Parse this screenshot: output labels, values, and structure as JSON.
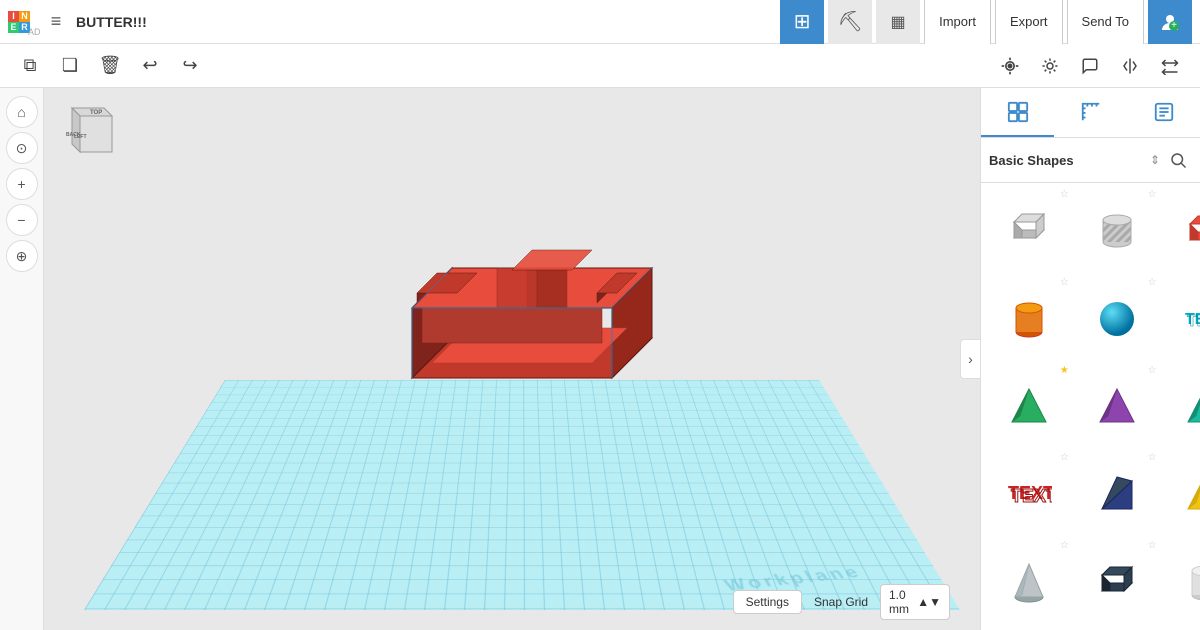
{
  "app": {
    "logo_letters": [
      "I",
      "N",
      "E",
      "R",
      "A",
      "D"
    ],
    "project_title": "BUTTER!!!",
    "nav_tabs": [
      {
        "id": "grid",
        "icon": "⊞",
        "active": true
      },
      {
        "id": "tools",
        "icon": "⛏",
        "active": false
      },
      {
        "id": "layers",
        "icon": "▦",
        "active": false
      }
    ],
    "nav_actions": [
      "Import",
      "Export",
      "Send To"
    ],
    "user_icon": "👤"
  },
  "toolbar": {
    "tools": [
      {
        "id": "copy",
        "icon": "⧉"
      },
      {
        "id": "duplicate",
        "icon": "❏"
      },
      {
        "id": "delete",
        "icon": "🗑"
      },
      {
        "id": "undo",
        "icon": "↩"
      },
      {
        "id": "redo",
        "icon": "↪"
      }
    ],
    "right_tools": [
      {
        "id": "camera",
        "icon": "📷"
      },
      {
        "id": "light",
        "icon": "💡"
      },
      {
        "id": "comment",
        "icon": "💬"
      },
      {
        "id": "mirror",
        "icon": "⟺"
      },
      {
        "id": "flip",
        "icon": "⟳"
      }
    ]
  },
  "left_sidebar": {
    "buttons": [
      {
        "id": "home",
        "icon": "⌂"
      },
      {
        "id": "fit",
        "icon": "⊙"
      },
      {
        "id": "zoom-in",
        "icon": "+"
      },
      {
        "id": "zoom-out",
        "icon": "−"
      },
      {
        "id": "orbit",
        "icon": "⊕"
      }
    ]
  },
  "viewport": {
    "workplane_label": "Workplane",
    "settings_label": "Settings",
    "snap_grid_label": "Snap Grid",
    "snap_grid_value": "1.0 mm"
  },
  "right_panel": {
    "tabs": [
      {
        "id": "shapes",
        "icon": "⊞",
        "active": true
      },
      {
        "id": "rulers",
        "icon": "📐",
        "active": false
      },
      {
        "id": "notes",
        "icon": "📝",
        "active": false
      }
    ],
    "shapes_category": "Basic Shapes",
    "shapes": [
      {
        "id": "box",
        "label": "Box",
        "color": "#aaa",
        "starred": false
      },
      {
        "id": "cylinder-striped",
        "label": "Cylinder Striped",
        "color": "#bbb",
        "starred": false
      },
      {
        "id": "box-red",
        "label": "Box Red",
        "color": "#e74c3c",
        "starred": false
      },
      {
        "id": "cylinder",
        "label": "Cylinder",
        "color": "#e67e22",
        "starred": false
      },
      {
        "id": "sphere",
        "label": "Sphere",
        "color": "#00aacc",
        "starred": false
      },
      {
        "id": "text3d",
        "label": "3D Text",
        "color": "#cc3333",
        "starred": false
      },
      {
        "id": "pyramid-green",
        "label": "Pyramid Green",
        "color": "#27ae60",
        "starred": true
      },
      {
        "id": "pyramid-purple",
        "label": "Pyramid Purple",
        "color": "#8e44ad",
        "starred": false
      },
      {
        "id": "pyramid-teal",
        "label": "Pyramid Teal",
        "color": "#1abc9c",
        "starred": false
      },
      {
        "id": "text-red",
        "label": "Text Red",
        "color": "#cc2222",
        "starred": false
      },
      {
        "id": "prism-blue",
        "label": "Prism Blue",
        "color": "#2c3e80",
        "starred": false
      },
      {
        "id": "pyramid-yellow",
        "label": "Pyramid Yellow",
        "color": "#f1c40f",
        "starred": false
      },
      {
        "id": "cone-gray",
        "label": "Cone Gray",
        "color": "#95a5a6",
        "starred": false
      },
      {
        "id": "box-blue",
        "label": "Box Blue",
        "color": "#34495e",
        "starred": false
      },
      {
        "id": "cylinder-white",
        "label": "Cylinder White",
        "color": "#ddd",
        "starred": false
      }
    ]
  }
}
